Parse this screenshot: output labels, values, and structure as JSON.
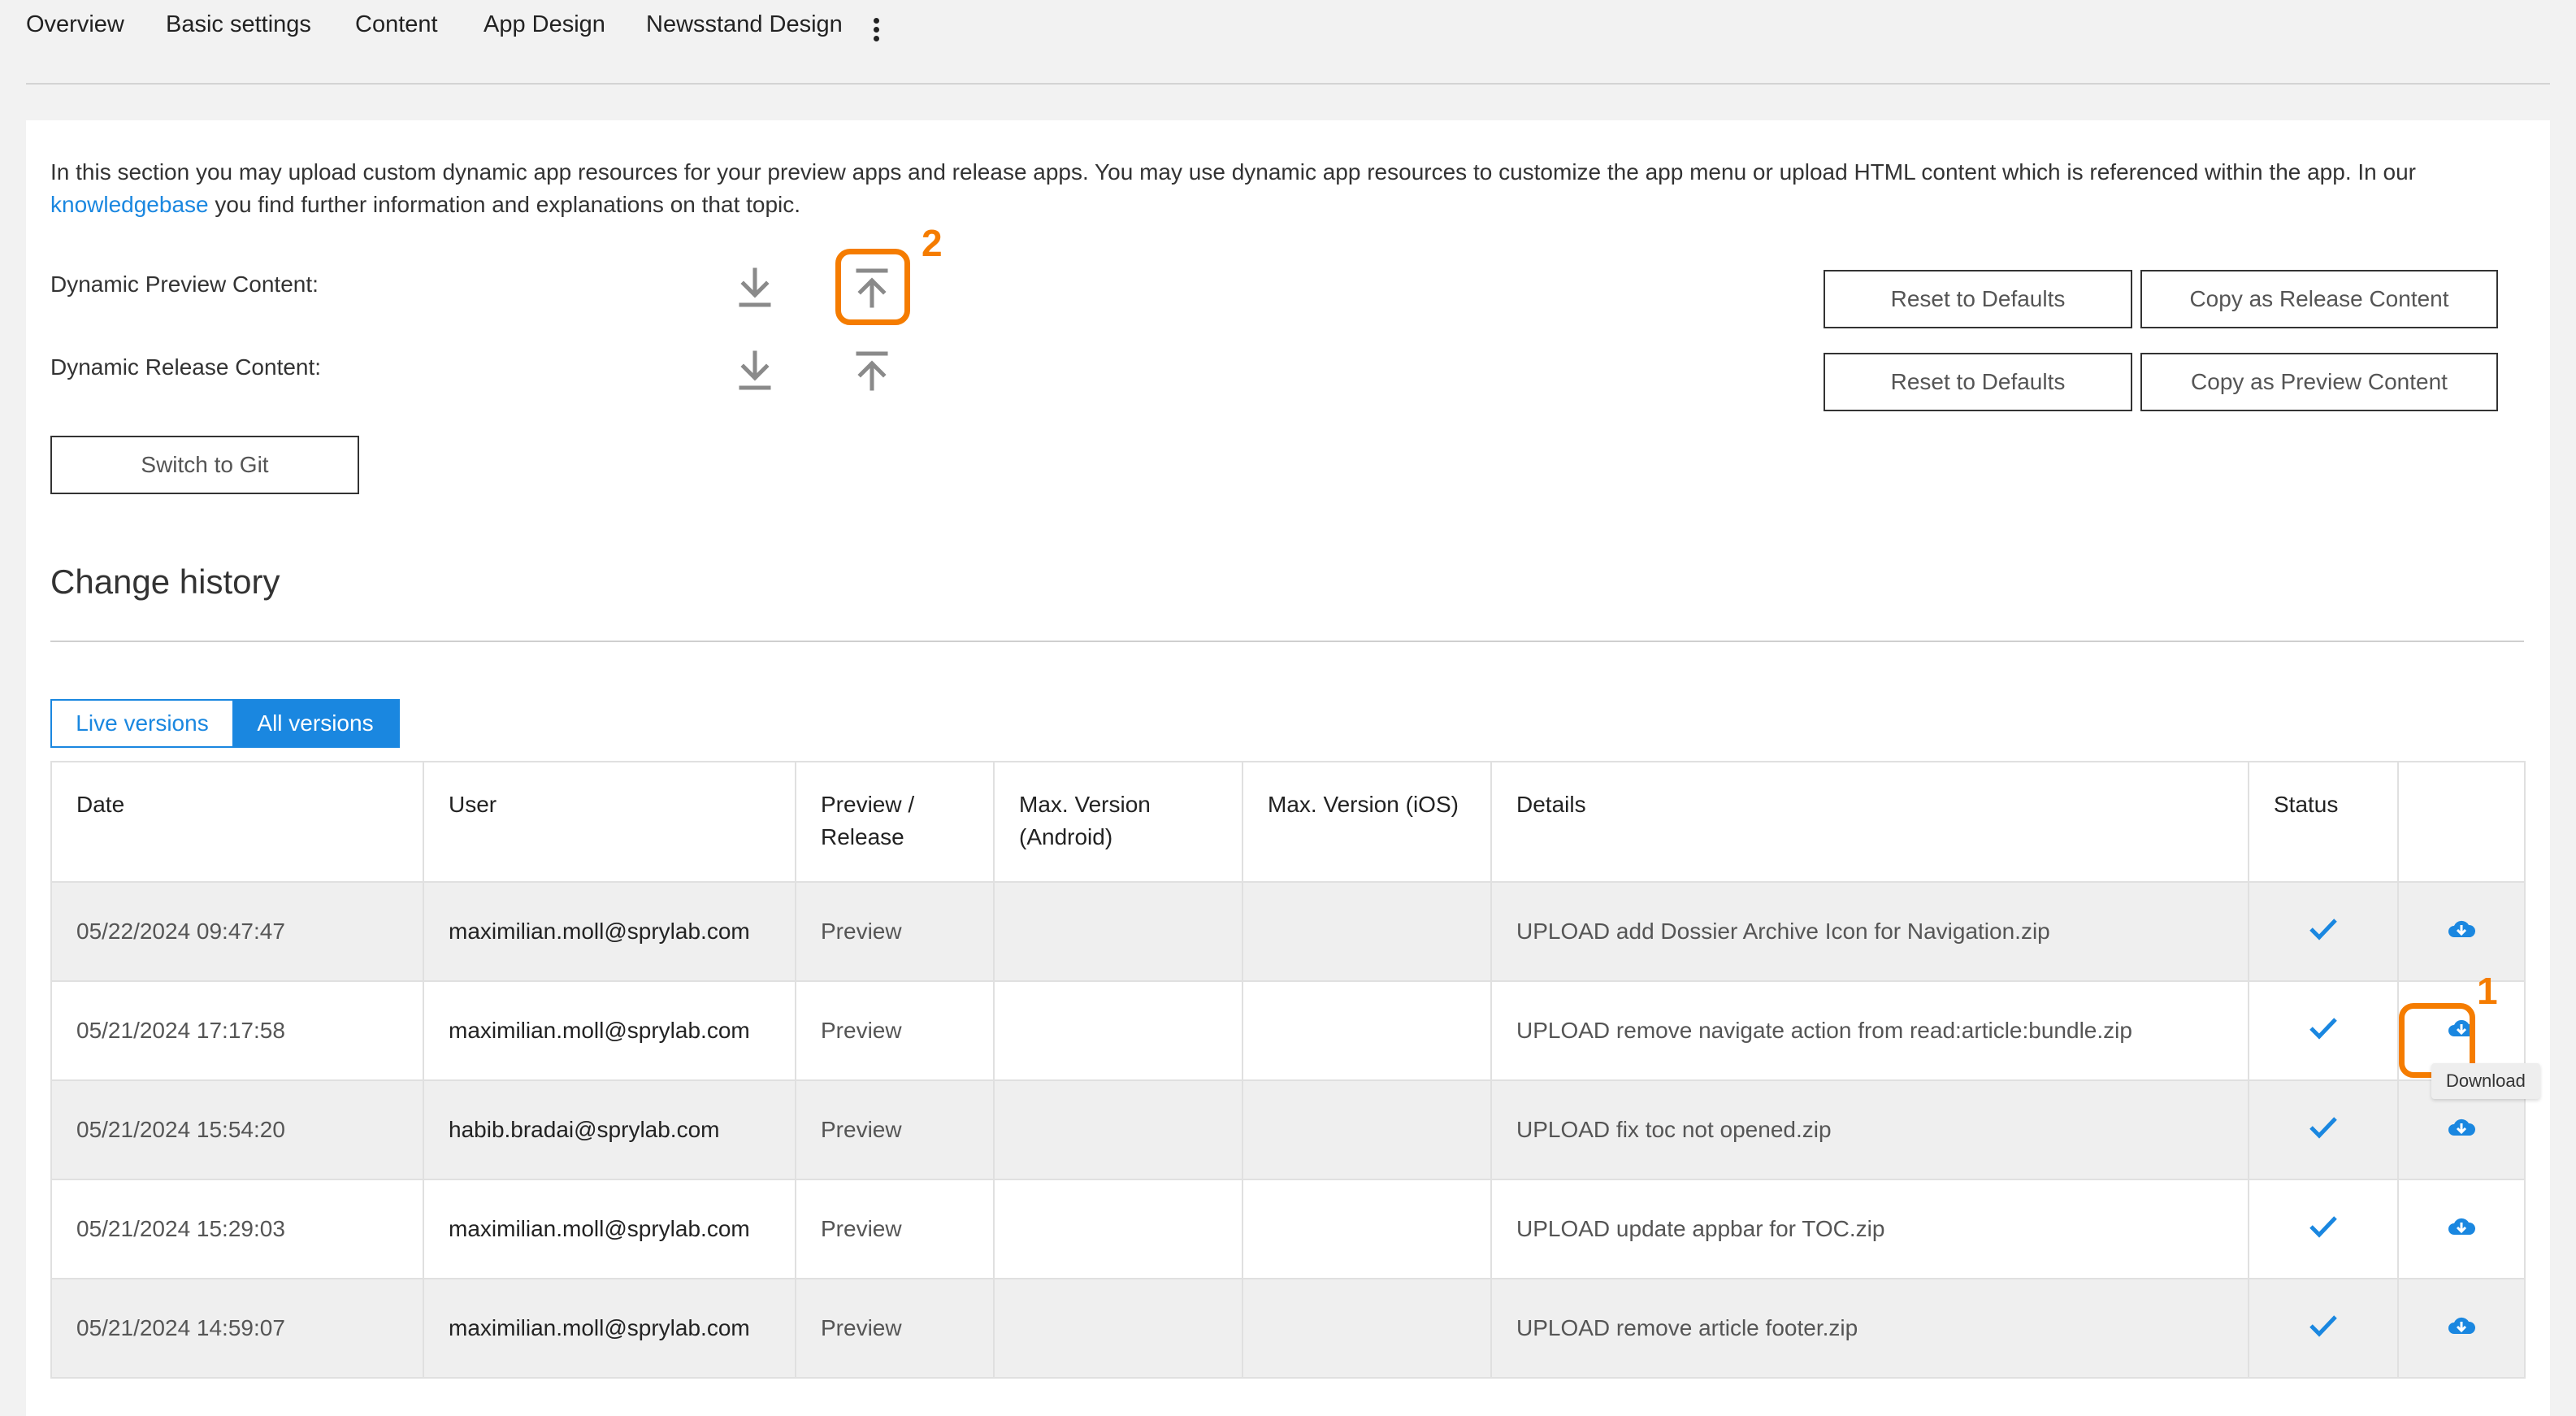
{
  "nav": {
    "tabs": [
      "Overview",
      "Basic settings",
      "Content",
      "App Design",
      "Newsstand Design"
    ],
    "more_icon": "more-vertical-icon"
  },
  "intro": {
    "text_before": "In this section you may upload custom dynamic app resources for your preview apps and release apps. You may use dynamic app resources to customize the app menu or upload HTML content which is referenced within the app. In our ",
    "link": "knowledgebase",
    "text_after": " you find further information and explanations on that topic."
  },
  "content_rows": [
    {
      "label": "Dynamic Preview Content:",
      "reset_label": "Reset to Defaults",
      "copy_label": "Copy as Release Content"
    },
    {
      "label": "Dynamic Release Content:",
      "reset_label": "Reset to Defaults",
      "copy_label": "Copy as Preview Content"
    }
  ],
  "icons": {
    "download": "download-icon",
    "upload": "upload-icon",
    "status": "check-icon",
    "row_download": "cloud-download-icon"
  },
  "switch_git_label": "Switch to Git",
  "history": {
    "title": "Change history",
    "toggle": {
      "live": "Live versions",
      "all": "All versions",
      "active": "all"
    },
    "columns": [
      "Date",
      "User",
      "Preview / Release",
      "Max. Version (Android)",
      "Max. Version (iOS)",
      "Details",
      "Status",
      ""
    ],
    "rows": [
      {
        "date": "05/22/2024 09:47:47",
        "user": "maximilian.moll@sprylab.com",
        "type": "Preview",
        "android": "",
        "ios": "",
        "details": "UPLOAD add Dossier Archive Icon for Navigation.zip"
      },
      {
        "date": "05/21/2024 17:17:58",
        "user": "maximilian.moll@sprylab.com",
        "type": "Preview",
        "android": "",
        "ios": "",
        "details": "UPLOAD remove navigate action from read:article:bundle.zip"
      },
      {
        "date": "05/21/2024 15:54:20",
        "user": "habib.bradai@sprylab.com",
        "type": "Preview",
        "android": "",
        "ios": "",
        "details": "UPLOAD fix toc not opened.zip"
      },
      {
        "date": "05/21/2024 15:29:03",
        "user": "maximilian.moll@sprylab.com",
        "type": "Preview",
        "android": "",
        "ios": "",
        "details": "UPLOAD update appbar for TOC.zip"
      },
      {
        "date": "05/21/2024 14:59:07",
        "user": "maximilian.moll@sprylab.com",
        "type": "Preview",
        "android": "",
        "ios": "",
        "details": "UPLOAD remove article footer.zip"
      }
    ]
  },
  "tooltip": "Download",
  "callouts": [
    "1",
    "2"
  ],
  "colors": {
    "accent": "#1a87e0",
    "callout": "#f57c00",
    "icon_gray": "#8a8a8a"
  }
}
